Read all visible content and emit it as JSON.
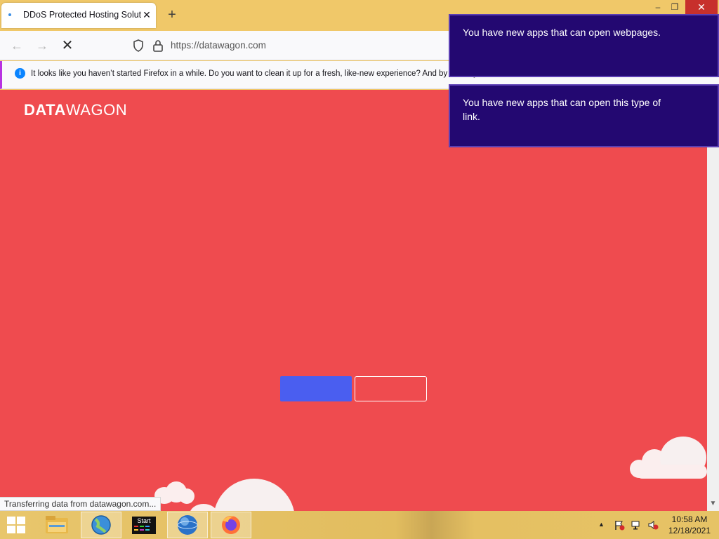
{
  "browser": {
    "tab": {
      "title": "DDoS Protected Hosting Solutio",
      "close_label": "✕"
    },
    "new_tab_label": "+",
    "window_controls": {
      "minimize": "–",
      "maximize": "❐",
      "close": "✕"
    },
    "nav": {
      "back": "←",
      "forward": "→",
      "stop": "✕"
    },
    "url": "https://datawagon.com",
    "notification": {
      "text": "It looks like you haven’t started Firefox in a while. Do you want to clean it up for a fresh, like-new experience? And by the way, welcome back!",
      "icon": "info-icon"
    },
    "status_text": "Transferring data from datawagon.com..."
  },
  "page": {
    "logo_bold": "DATA",
    "logo_light": "WAGON",
    "background_color": "#ef4b4f",
    "primary_button_color": "#4a5ef0"
  },
  "toasts": [
    {
      "text": "You have new apps that can open webpages."
    },
    {
      "text": "You have new apps that can open this type of link."
    }
  ],
  "taskbar": {
    "items": [
      {
        "name": "file-explorer-icon"
      },
      {
        "name": "network-globe-icon"
      },
      {
        "name": "start-app-icon",
        "label": "Start"
      },
      {
        "name": "internet-explorer-icon"
      },
      {
        "name": "firefox-icon"
      }
    ],
    "tray": {
      "show_hidden": "▲",
      "flag_icon": "action-center-flag-icon",
      "network_icon": "network-icon",
      "volume_icon": "volume-muted-icon"
    },
    "time": "10:58 AM",
    "date": "12/18/2021"
  }
}
